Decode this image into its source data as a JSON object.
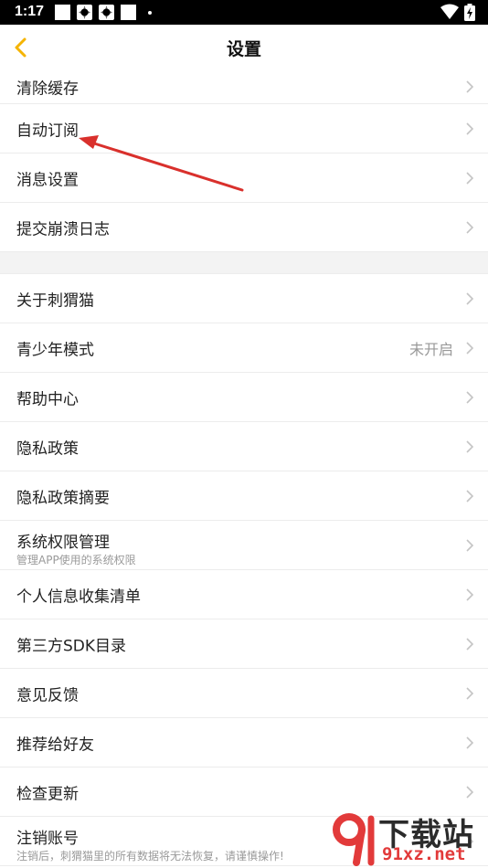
{
  "status_bar": {
    "time": "1:17"
  },
  "navbar": {
    "title": "设置"
  },
  "colors": {
    "accent": "#f5b400",
    "arrow": "#d9302c",
    "chevron": "#c4c4c4",
    "watermark_red": "#e23a3a"
  },
  "list_top": [
    {
      "label": "清除缓存"
    },
    {
      "label": "自动订阅"
    },
    {
      "label": "消息设置"
    },
    {
      "label": "提交崩溃日志"
    }
  ],
  "list_bottom": [
    {
      "label": "关于刺猬猫"
    },
    {
      "label": "青少年模式",
      "value": "未开启"
    },
    {
      "label": "帮助中心"
    },
    {
      "label": "隐私政策"
    },
    {
      "label": "隐私政策摘要"
    },
    {
      "label": "系统权限管理",
      "sub": "管理APP使用的系统权限"
    },
    {
      "label": "个人信息收集清单"
    },
    {
      "label": "第三方SDK目录"
    },
    {
      "label": "意见反馈"
    },
    {
      "label": "推荐给好友"
    },
    {
      "label": "检查更新"
    },
    {
      "label": "注销账号",
      "sub": "注销后，刺猬猫里的所有数据将无法恢复，请谨慎操作!"
    }
  ],
  "watermark": {
    "brand": "下载站",
    "url": "91xz.net"
  }
}
